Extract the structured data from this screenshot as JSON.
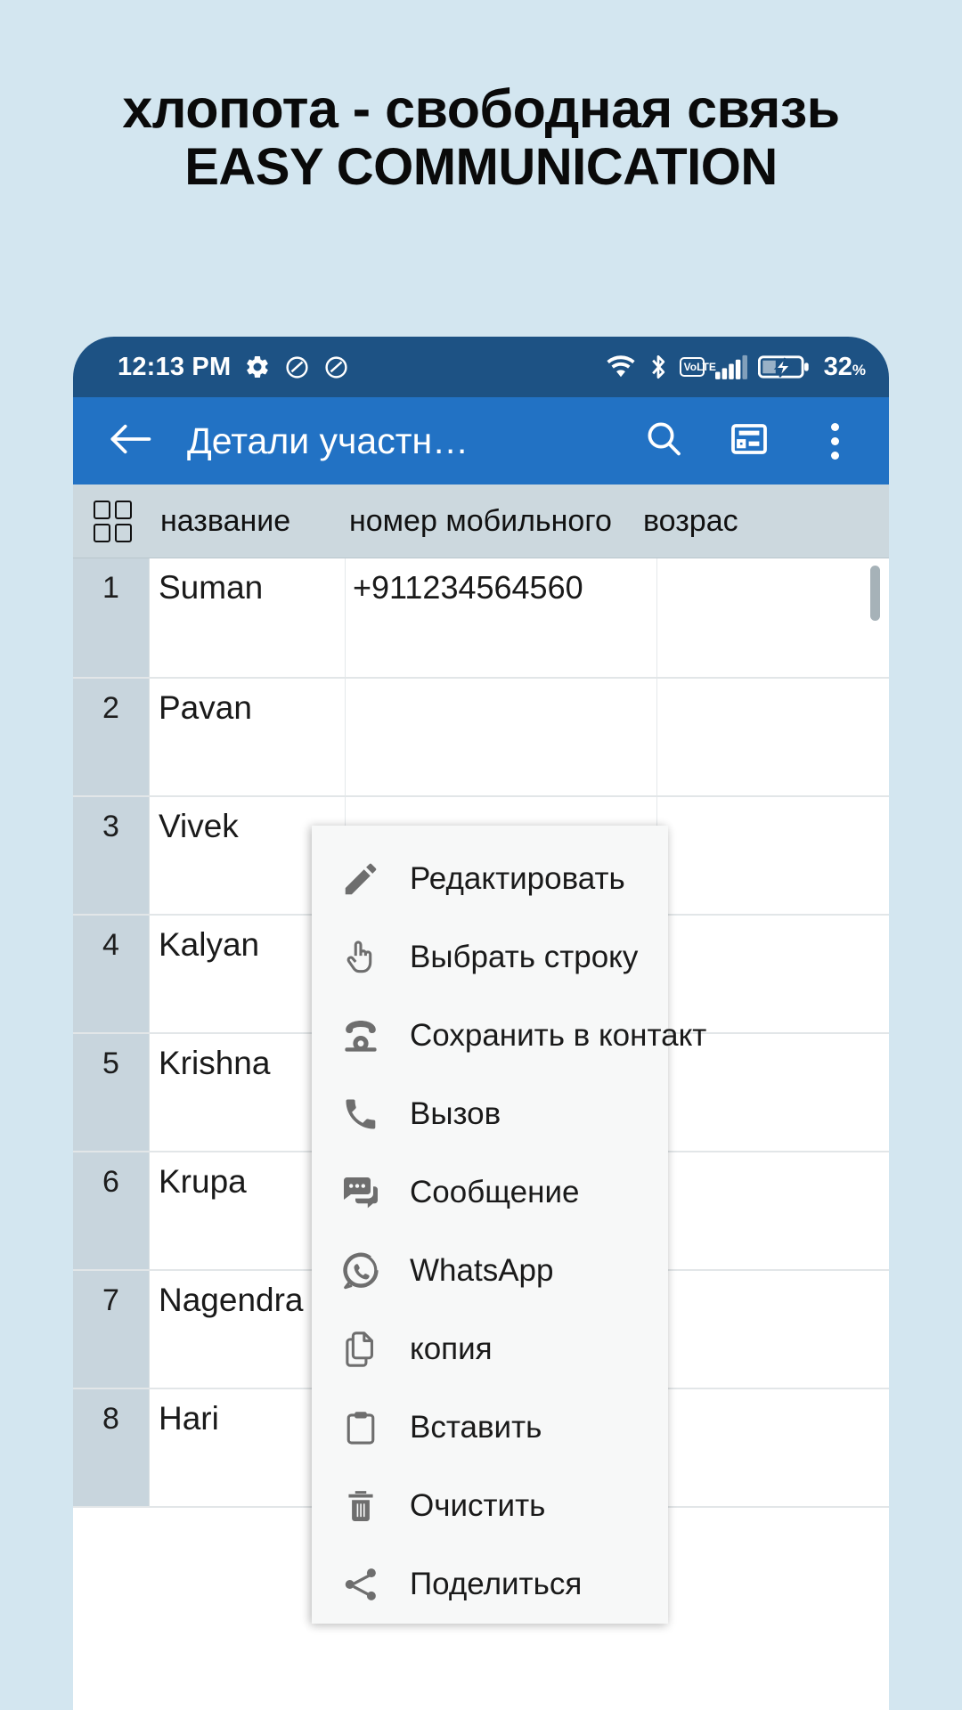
{
  "promo": {
    "line1": "хлопота - свободная связь",
    "line2": "EASY COMMUNICATION",
    "background_color": "#d3e6f0"
  },
  "status_bar": {
    "time": "12:13 PM",
    "icons": [
      "gear-icon",
      "do-not-disturb-icon",
      "do-not-disturb-icon",
      "wifi-icon",
      "bluetooth-icon",
      "volte-icon",
      "signal-icon",
      "battery-charging-icon"
    ],
    "volte_top": "Vo",
    "volte_bottom": "LTE",
    "battery_percent": "32",
    "battery_percent_symbol": "%",
    "background_color": "#1d5284"
  },
  "app_bar": {
    "title": "Детали участн…",
    "back_label": "back-arrow",
    "actions": [
      "search-icon",
      "card-view-icon",
      "overflow-menu-icon"
    ],
    "background_color": "#2272c4"
  },
  "table": {
    "columns": [
      "название",
      "номер мобильного",
      "возрас"
    ],
    "grid_toggle": "grid-icon",
    "rows": [
      {
        "index": "1",
        "name": "Suman",
        "mobile": "+911234564560",
        "age": ""
      },
      {
        "index": "2",
        "name": "Pavan",
        "mobile": "",
        "age": ""
      },
      {
        "index": "3",
        "name": "Vivek",
        "mobile": "",
        "age": ""
      },
      {
        "index": "4",
        "name": "Kalyan",
        "mobile": "",
        "age": ""
      },
      {
        "index": "5",
        "name": "Krishna",
        "mobile": "",
        "age": ""
      },
      {
        "index": "6",
        "name": "Krupa",
        "mobile": "",
        "age": ""
      },
      {
        "index": "7",
        "name": "Nagendra",
        "mobile": "",
        "age": ""
      },
      {
        "index": "8",
        "name": "Hari",
        "mobile": "",
        "age": ""
      }
    ]
  },
  "context_menu": {
    "items": [
      {
        "label": "Редактировать",
        "icon": "pencil-icon"
      },
      {
        "label": "Выбрать строку",
        "icon": "pointing-hand-icon"
      },
      {
        "label": "Сохранить в контакт",
        "icon": "telephone-icon"
      },
      {
        "label": "Вызов",
        "icon": "phone-handset-icon"
      },
      {
        "label": "Сообщение",
        "icon": "chat-bubble-icon"
      },
      {
        "label": "WhatsApp",
        "icon": "whatsapp-icon"
      },
      {
        "label": "копия",
        "icon": "copy-icon"
      },
      {
        "label": "Вставить",
        "icon": "clipboard-icon"
      },
      {
        "label": "Очистить",
        "icon": "trash-icon"
      },
      {
        "label": "Поделиться",
        "icon": "share-icon"
      }
    ]
  }
}
